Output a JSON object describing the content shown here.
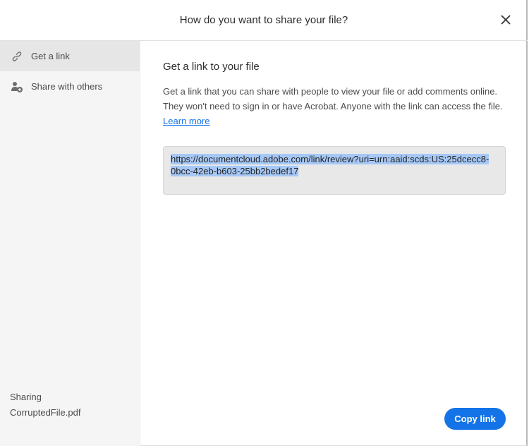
{
  "header": {
    "title": "How do you want to share your file?"
  },
  "sidebar": {
    "items": [
      {
        "label": "Get a link",
        "icon": "link-icon"
      },
      {
        "label": "Share with others",
        "icon": "add-person-icon"
      }
    ],
    "sharing_label": "Sharing",
    "file_name": "CorruptedFile.pdf"
  },
  "main": {
    "heading": "Get a link to your file",
    "description": "Get a link that you can share with people to view your file or add comments online. They won't need to sign in or have Acrobat. Anyone with the link can access the file.",
    "learn_more": "Learn more",
    "link": "https://documentcloud.adobe.com/link/review?uri=urn:aaid:scds:US:25dcecc8-0bcc-42eb-b603-25bb2bedef17",
    "copy_label": "Copy link"
  },
  "colors": {
    "accent": "#1473e6",
    "selection": "#a6c8f6"
  }
}
